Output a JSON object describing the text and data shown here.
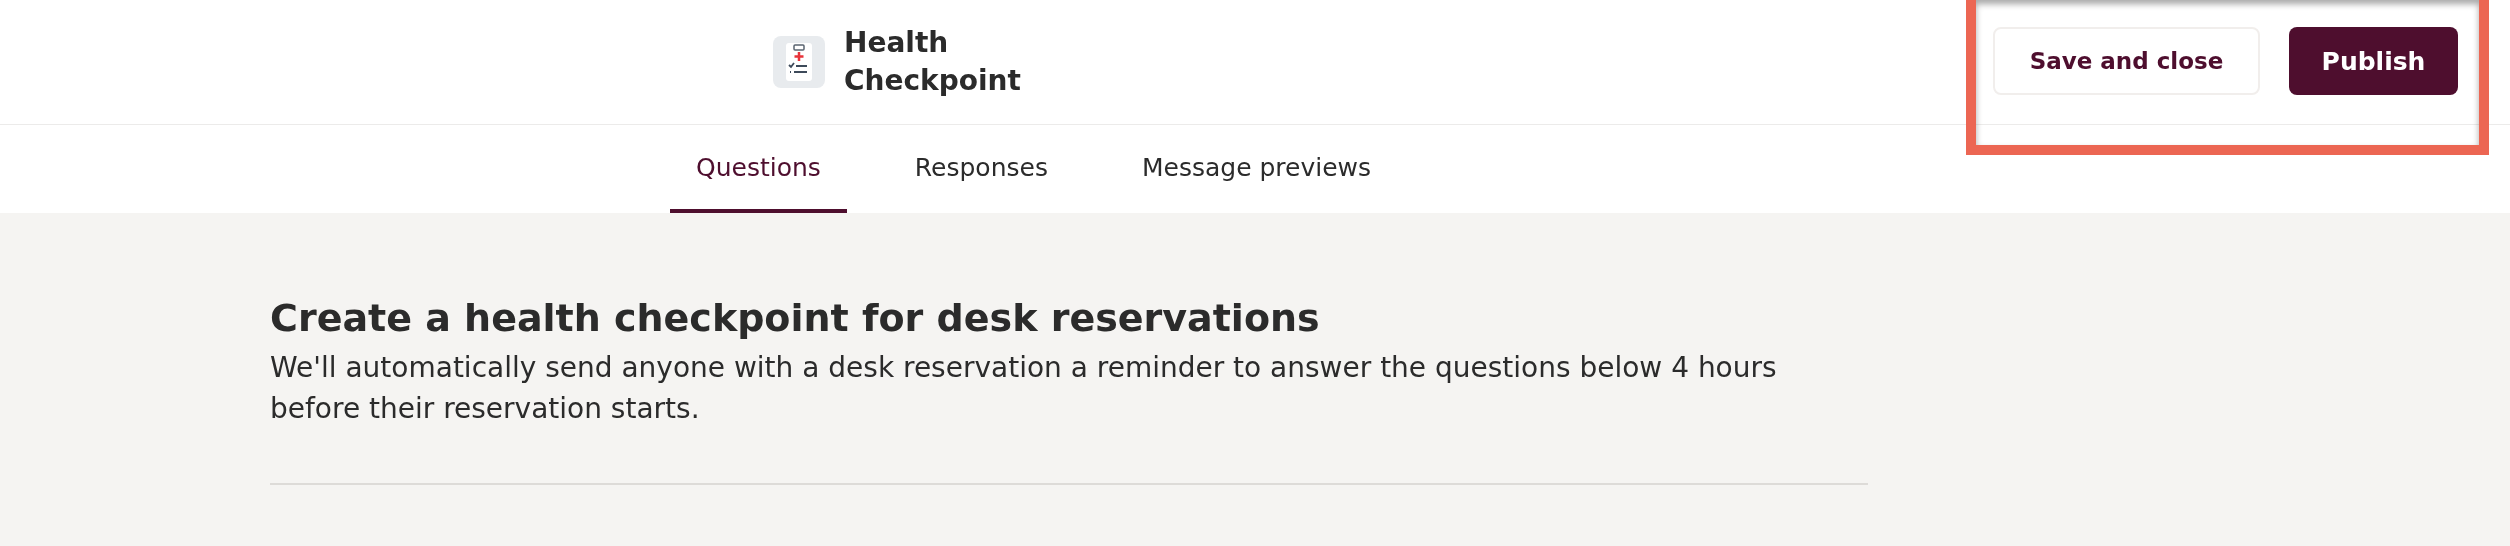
{
  "header": {
    "title": "Health Checkpoint",
    "buttons": [
      {
        "label": "Save and close",
        "kind": "secondary"
      },
      {
        "label": "Publish",
        "kind": "primary"
      }
    ]
  },
  "tabs": [
    {
      "label": "Questions",
      "selected": true
    },
    {
      "label": "Responses",
      "selected": false
    },
    {
      "label": "Message previews",
      "selected": false
    }
  ],
  "content": {
    "heading": "Create a health checkpoint for desk reservations",
    "description": "We'll automatically send anyone with a desk reservation a reminder to answer the questions below 4 hours before their reservation starts."
  }
}
